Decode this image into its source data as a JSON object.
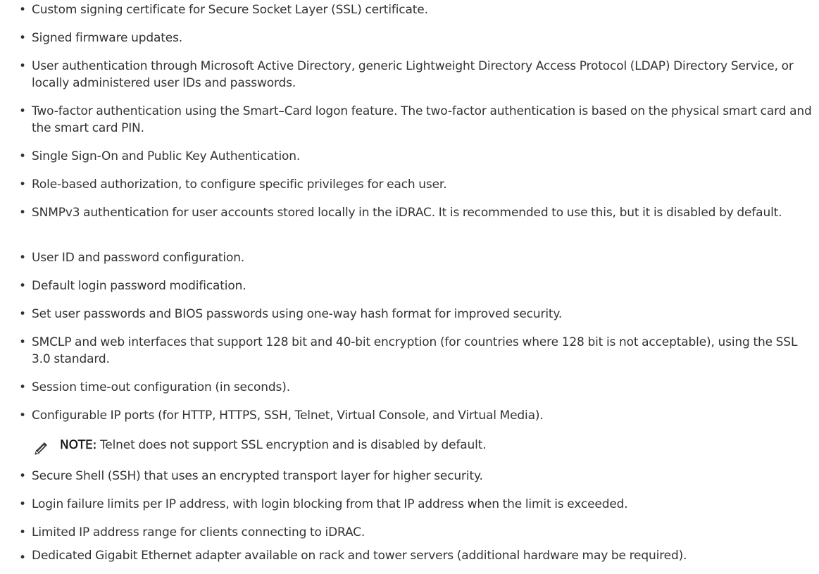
{
  "features": [
    "Custom signing certificate for Secure Socket Layer (SSL) certificate.",
    "Signed firmware updates.",
    "User authentication through Microsoft Active Directory, generic Lightweight Directory Access Protocol (LDAP) Directory Service, or locally administered user IDs and passwords.",
    "Two-factor authentication using the Smart–Card logon feature. The two-factor authentication is based on the physical smart card and the smart card PIN.",
    "Single Sign-On and Public Key Authentication.",
    "Role-based authorization, to configure specific privileges for each user.",
    "SNMPv3 authentication for user accounts stored locally in the iDRAC. It is recommended to use this, but it is disabled by default.",
    "User ID and password configuration.",
    "Default login password modification.",
    "Set user passwords and BIOS passwords using one-way hash format for improved security.",
    "SMCLP and web interfaces that support 128 bit and 40-bit encryption (for countries where 128 bit is not acceptable), using the SSL 3.0 standard.",
    "Session time-out configuration (in seconds).",
    "Configurable IP ports (for HTTP, HTTPS, SSH, Telnet, Virtual Console, and Virtual Media).",
    "Secure Shell (SSH) that uses an encrypted transport layer for higher security.",
    "Login failure limits per IP address, with login blocking from that IP address when the limit is exceeded.",
    "Limited IP address range for clients connecting to iDRAC.",
    "Dedicated Gigabit Ethernet adapter available on rack and tower servers (additional hardware may be required)."
  ],
  "bullet_glyph": "•",
  "note": {
    "label": "NOTE:",
    "text": " Telnet does not support SSL encryption and is disabled by default.",
    "icon": "pencil-note-icon"
  },
  "colors": {
    "text": "#333333",
    "icon": "#3a3a3a"
  }
}
